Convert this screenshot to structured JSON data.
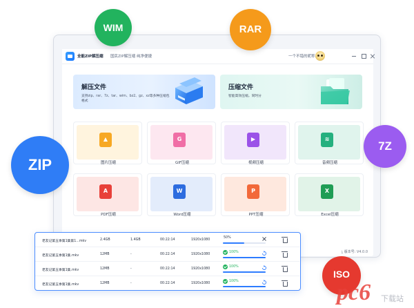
{
  "badges": {
    "wim": {
      "label": "WIM",
      "color": "#22b35e"
    },
    "rar": {
      "label": "RAR",
      "color": "#f59a1b"
    },
    "zip": {
      "label": "ZIP",
      "color": "#2f7df6"
    },
    "sevenz": {
      "label": "7Z",
      "color": "#9b5cf0"
    },
    "iso": {
      "label": "ISO",
      "color": "#e5392f"
    }
  },
  "titlebar": {
    "app_name": "全能ZIP解压缩",
    "promo": "国民ZIP解压缩  纯净便捷",
    "user_name": "一个不错的昵称..."
  },
  "hero": {
    "extract": {
      "title": "解压文件",
      "desc": "支持zip、rar、7z、tar、wim、bz2、gz、xz等多种压缩包格式"
    },
    "compress": {
      "title": "压缩文件",
      "desc": "智能高效压缩，同时分"
    }
  },
  "tools": [
    {
      "label": "图片压缩",
      "glyph": "▲",
      "icon_color": "#f7a823",
      "bg": "#fff4de"
    },
    {
      "label": "GIF压缩",
      "glyph": "G",
      "icon_color": "#f06ea6",
      "bg": "#fde7f0"
    },
    {
      "label": "视频压缩",
      "glyph": "▶",
      "icon_color": "#9b52e8",
      "bg": "#f1e6fb"
    },
    {
      "label": "音频压缩",
      "glyph": "≋",
      "icon_color": "#25b07f",
      "bg": "#e0f4ed"
    },
    {
      "label": "PDF压缩",
      "glyph": "A",
      "icon_color": "#e8413a",
      "bg": "#fde6e4"
    },
    {
      "label": "Word压缩",
      "glyph": "W",
      "icon_color": "#2d6cdf",
      "bg": "#e3ecfb"
    },
    {
      "label": "PPT压缩",
      "glyph": "P",
      "icon_color": "#f2693a",
      "bg": "#fee8de"
    },
    {
      "label": "Excel压缩",
      "glyph": "X",
      "icon_color": "#1f9d55",
      "bg": "#e1f3e8"
    }
  ],
  "bottombar": {
    "right": "⤓ 版本号:  V4.0.0"
  },
  "tasks": [
    {
      "name": "老友记第五季第1集第1...mkv",
      "size_before": "2.4GB",
      "size_after": "1.4GB",
      "duration": "00:22:14",
      "resolution": "1920x1080",
      "progress_text": "50%",
      "progress": 0.5,
      "done": false
    },
    {
      "name": "老友记第五季第1集.mkv",
      "size_before": "12MB",
      "size_after": "-",
      "duration": "00:22:14",
      "resolution": "1920x1080",
      "progress_text": "100%",
      "progress": 1.0,
      "done": true
    },
    {
      "name": "老友记第五季第1集.mkv",
      "size_before": "12MB",
      "size_after": "-",
      "duration": "00:22:14",
      "resolution": "1920x1080",
      "progress_text": "100%",
      "progress": 1.0,
      "done": true
    },
    {
      "name": "老友记第五季第1集.mkv",
      "size_before": "12MB",
      "size_after": "-",
      "duration": "00:22:14",
      "resolution": "1920x1080",
      "progress_text": "100%",
      "progress": 1.0,
      "done": true
    }
  ],
  "watermark": {
    "text": "pc6",
    "sub": "下载站"
  }
}
